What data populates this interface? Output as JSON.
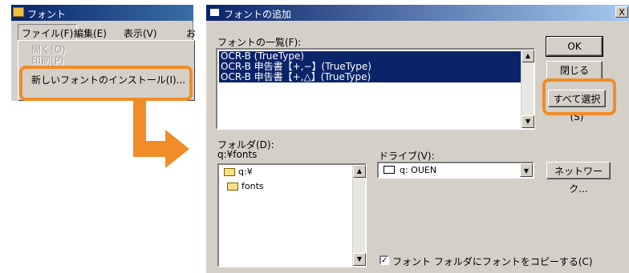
{
  "fonts_window": {
    "title": "フォント",
    "menu": [
      "ファイル(F)",
      "編集(E)",
      "表示(V)",
      "お"
    ],
    "dropdown": [
      {
        "label": "開く(O)",
        "enabled": false
      },
      {
        "label": "印刷(P)",
        "enabled": false
      },
      {
        "label": "新しいフォントのインストール(I)...",
        "enabled": true
      }
    ]
  },
  "dialog": {
    "title": "フォントの追加",
    "close": "X",
    "font_list_label": "フォントの一覧(F):",
    "font_list": [
      "OCR-B (TrueType)",
      "OCR-B 申告書【+,−】(TrueType)",
      "OCR-B 申告書【+,△】(TrueType)"
    ],
    "ok_label": "OK",
    "close_label": "閉じる",
    "select_all_label": "すべて選択(S)",
    "folder_label": "フォルダ(D):",
    "folder_path": "q:¥fonts",
    "drive_label": "ドライブ(V):",
    "drive_value": "q: OUEN",
    "network_label": "ネットワーク...",
    "folder_tree": [
      "q:¥",
      "fonts"
    ],
    "copy_checkbox_label": "フォント フォルダにフォントをコピーする(C)",
    "copy_checked": true
  },
  "colors": {
    "highlight": "#f08c28",
    "selection": "#0a246a"
  }
}
